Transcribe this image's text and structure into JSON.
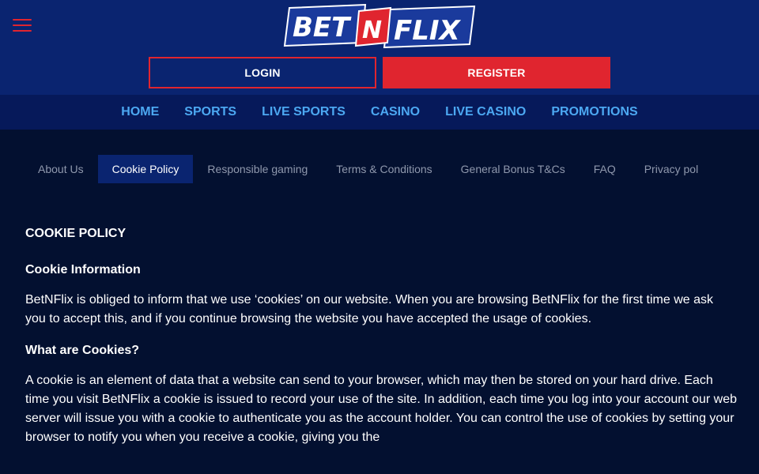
{
  "header": {
    "menu_icon": "hamburger-menu-icon",
    "logo": {
      "part1": "BET",
      "part2": "N",
      "part3": "FLIX",
      "colors": {
        "white": "#ffffff",
        "red": "#e0252f",
        "blue": "#1a3a9c"
      }
    },
    "login_label": "LOGIN",
    "register_label": "REGISTER"
  },
  "main_nav": {
    "items": [
      {
        "label": "HOME"
      },
      {
        "label": "SPORTS"
      },
      {
        "label": "LIVE SPORTS"
      },
      {
        "label": "CASINO"
      },
      {
        "label": "LIVE CASINO"
      },
      {
        "label": "PROMOTIONS"
      }
    ]
  },
  "sub_nav": {
    "items": [
      {
        "label": "About Us",
        "active": false
      },
      {
        "label": "Cookie Policy",
        "active": true
      },
      {
        "label": "Responsible gaming",
        "active": false
      },
      {
        "label": "Terms & Conditions",
        "active": false
      },
      {
        "label": "General Bonus T&Cs",
        "active": false
      },
      {
        "label": "FAQ",
        "active": false
      },
      {
        "label": "Privacy pol",
        "active": false
      }
    ]
  },
  "content": {
    "title": "COOKIE POLICY",
    "sections": [
      {
        "heading": "Cookie Information",
        "text": "BetNFlix is obliged to inform that we use ‘cookies’ on our website. When you are browsing BetNFlix for the first time we ask you to accept this, and if you continue browsing the website you have accepted the usage of cookies."
      },
      {
        "heading": "What are Cookies?",
        "text": "A cookie is an element of data that a website can send to your browser, which may then be stored on your hard drive. Each time you visit BetNFlix a cookie is issued to record your use of the site. In addition, each time you log into your account our web server will issue you with a cookie to authenticate you as the account holder. You can control the use of cookies by setting your browser to notify you when you receive a cookie, giving you the"
      }
    ]
  },
  "colors": {
    "page_bg": "#031030",
    "header_bg": "#0a2470",
    "nav_bg": "#06195a",
    "nav_link": "#4ca8f2",
    "accent_red": "#e0252f",
    "subnav_text": "#8f98ad"
  }
}
